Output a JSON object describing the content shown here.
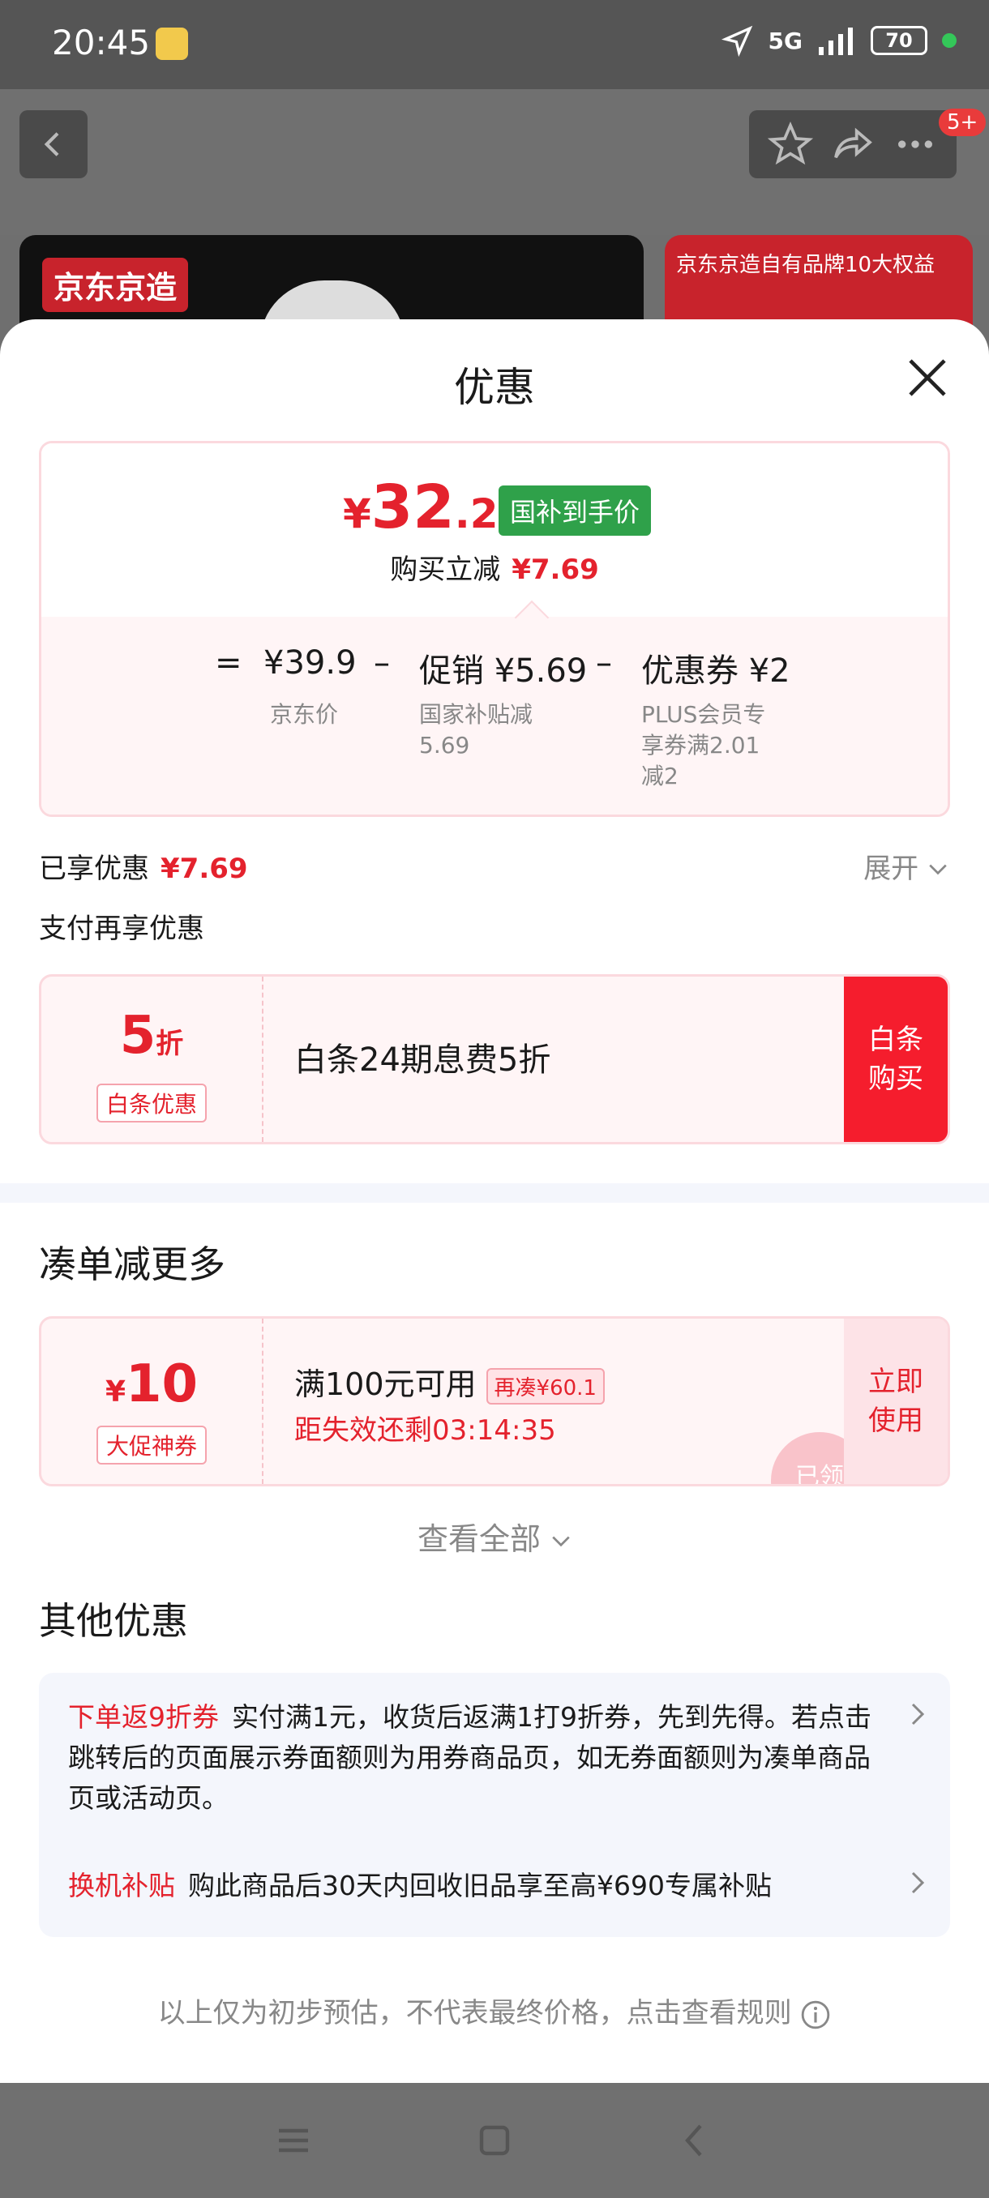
{
  "status_bar": {
    "time": "20:45",
    "network": "5G",
    "battery": "70"
  },
  "header": {
    "notification_badge": "5+"
  },
  "background_product": {
    "brand_tag": "京东京造",
    "side_banner": "京东京造自有品牌10大权益"
  },
  "sheet": {
    "title": "优惠",
    "price_summary": {
      "currency": "¥",
      "final_price_int": "32",
      "final_price_dec": ".21",
      "final_price_tag": "国补到手价",
      "reduce_label": "购买立减",
      "reduce_amount": "¥7.69",
      "formula": {
        "equals": "=",
        "base_price": "¥39.9",
        "base_label": "京东价",
        "minus": "–",
        "promo": "促销 ¥5.69",
        "promo_sub_1": "国家补贴减",
        "promo_sub_2": "5.69",
        "coupon": "优惠券 ¥2",
        "coupon_sub_1": "PLUS会员专",
        "coupon_sub_2": "享券满2.01",
        "coupon_sub_3": "减2"
      }
    },
    "enjoyed_label": "已享优惠",
    "enjoyed_amount": "¥7.69",
    "expand_label": "展开",
    "pay_more_label": "支付再享优惠",
    "baitiao": {
      "discount_num": "5",
      "discount_unit": "折",
      "tag": "白条优惠",
      "description": "白条24期息费5折",
      "button": "白条购买"
    },
    "collect_title": "凑单减更多",
    "coupon": {
      "currency": "¥",
      "amount": "10",
      "tag": "大促神券",
      "condition": "满100元可用",
      "extra": "再凑¥60.1",
      "timer_label": "距失效还剩",
      "timer": "03:14:35",
      "button": "立即使用",
      "stamp": "已领"
    },
    "view_all": "查看全部",
    "other_title": "其他优惠",
    "other_offers": [
      {
        "tag": "下单返9折券",
        "text": "实付满1元，收货后返满1打9折券，先到先得。若点击跳转后的页面展示券面额则为用券商品页，如无券面额则为凑单商品页或活动页。"
      },
      {
        "tag": "换机补贴",
        "text": "购此商品后30天内回收旧品享至高¥690专属补贴"
      }
    ],
    "disclaimer": "以上仅为初步预估，不代表最终价格，点击查看规则"
  },
  "icons": [
    "back-icon",
    "star-icon",
    "share-icon",
    "more-icon",
    "close-icon",
    "chevron-down-icon",
    "chevron-right-icon",
    "info-icon",
    "menu-icon",
    "home-icon",
    "back-nav-icon"
  ]
}
